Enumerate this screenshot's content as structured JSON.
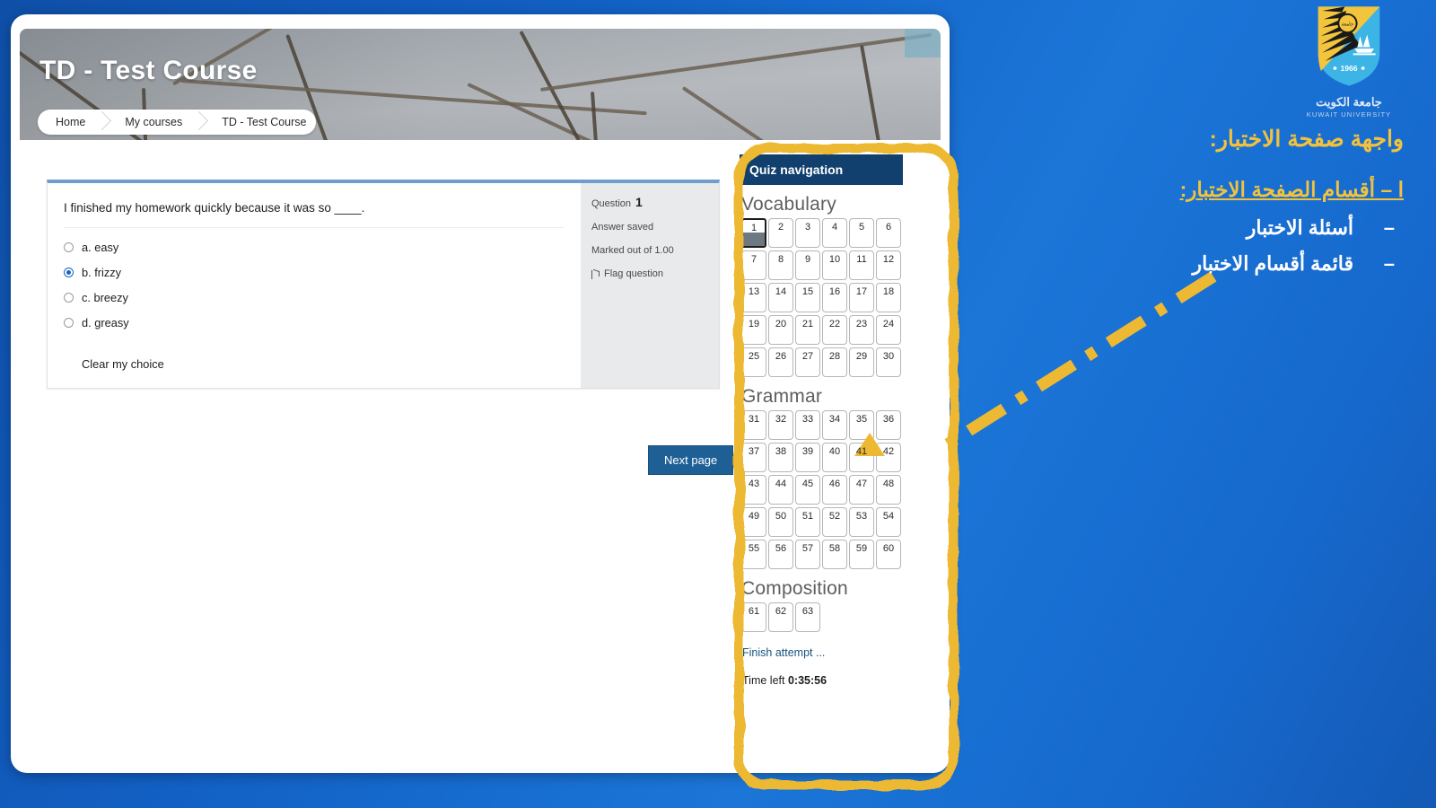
{
  "colors": {
    "bg_blue": "#1260c4",
    "accent_yellow": "#edb932",
    "nav_header_navy": "#11406e",
    "button_blue": "#1e6096",
    "answered_grey": "#6e7880"
  },
  "banner": {
    "course_title": "TD - Test Course"
  },
  "breadcrumb": {
    "items": [
      "Home",
      "My courses",
      "TD - Test Course"
    ]
  },
  "question": {
    "text": "I finished my homework quickly because it was so ____.",
    "options": [
      {
        "label": "a. easy",
        "selected": false
      },
      {
        "label": "b. frizzy",
        "selected": true
      },
      {
        "label": "c. breezy",
        "selected": false
      },
      {
        "label": "d. greasy",
        "selected": false
      }
    ],
    "clear_choice_label": "Clear my choice",
    "info": {
      "question_label": "Question",
      "question_number": "1",
      "answer_status": "Answer saved",
      "marked_out_of": "Marked out of 1.00",
      "flag_label": "Flag question"
    }
  },
  "next_page_label": "Next page",
  "quiz_nav": {
    "header": "Quiz navigation",
    "sections": [
      {
        "title": "Vocabulary",
        "questions": [
          1,
          2,
          3,
          4,
          5,
          6,
          7,
          8,
          9,
          10,
          11,
          12,
          13,
          14,
          15,
          16,
          17,
          18,
          19,
          20,
          21,
          22,
          23,
          24,
          25,
          26,
          27,
          28,
          29,
          30
        ],
        "current": 1,
        "answered": [
          1
        ]
      },
      {
        "title": "Grammar",
        "questions": [
          31,
          32,
          33,
          34,
          35,
          36,
          37,
          38,
          39,
          40,
          41,
          42,
          43,
          44,
          45,
          46,
          47,
          48,
          49,
          50,
          51,
          52,
          53,
          54,
          55,
          56,
          57,
          58,
          59,
          60
        ],
        "current": null,
        "answered": []
      },
      {
        "title": "Composition",
        "questions": [
          61,
          62,
          63
        ],
        "current": null,
        "answered": []
      }
    ],
    "finish_attempt_label": "Finish attempt ...",
    "time_left_label": "Time left",
    "time_left_value": "0:35:56"
  },
  "annotation": {
    "heading": "واجهة  صفحة الاختبار:",
    "subheading": "ا – أقسام الصفحة الاختبار:",
    "bullets": [
      "أسئلة الاختبار",
      "قائمة أقسام الاختبار"
    ],
    "bullet_dash": "–"
  },
  "logo": {
    "name_ar": "جامعة الكويت",
    "name_en": "KUWAIT UNIVERSITY",
    "year": "1966"
  }
}
